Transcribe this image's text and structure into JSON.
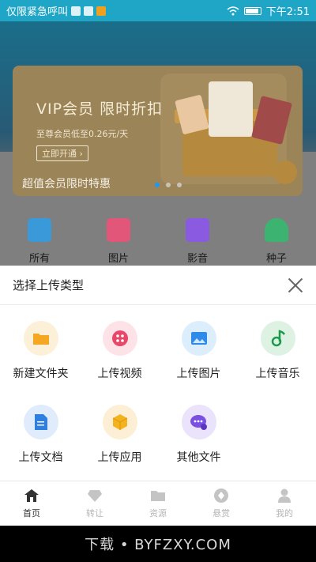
{
  "status_bar": {
    "carrier": "仅限紧急呼叫",
    "time": "下午2:51"
  },
  "banner": {
    "title": "VIP会员 限时折扣",
    "subtitle": "至尊会员低至0.26元/天",
    "button": "立即开通",
    "caption": "超值会员限时特惠"
  },
  "categories": [
    {
      "label": "所有",
      "color": "#3a9ad9"
    },
    {
      "label": "图片",
      "color": "#e2567a"
    },
    {
      "label": "影音",
      "color": "#8a5be0"
    },
    {
      "label": "种子",
      "color": "#3cb371"
    }
  ],
  "sheet": {
    "title": "选择上传类型",
    "items": [
      {
        "label": "新建文件夹",
        "icon": "folder-icon"
      },
      {
        "label": "上传视频",
        "icon": "video-icon"
      },
      {
        "label": "上传图片",
        "icon": "image-icon"
      },
      {
        "label": "上传音乐",
        "icon": "music-icon"
      },
      {
        "label": "上传文档",
        "icon": "document-icon"
      },
      {
        "label": "上传应用",
        "icon": "app-icon"
      },
      {
        "label": "其他文件",
        "icon": "other-file-icon"
      }
    ]
  },
  "bottom_nav": [
    {
      "label": "首页",
      "icon": "home-icon",
      "active": true
    },
    {
      "label": "转让",
      "icon": "diamond-icon",
      "active": false
    },
    {
      "label": "资源",
      "icon": "folder-icon",
      "active": false
    },
    {
      "label": "悬赏",
      "icon": "bounty-icon",
      "active": false
    },
    {
      "label": "我的",
      "icon": "user-icon",
      "active": false
    }
  ],
  "watermark": "下载 • BYFZXY.COM",
  "colors": {
    "accent": "#2196f3",
    "status_bar": "#1fa6c6"
  }
}
